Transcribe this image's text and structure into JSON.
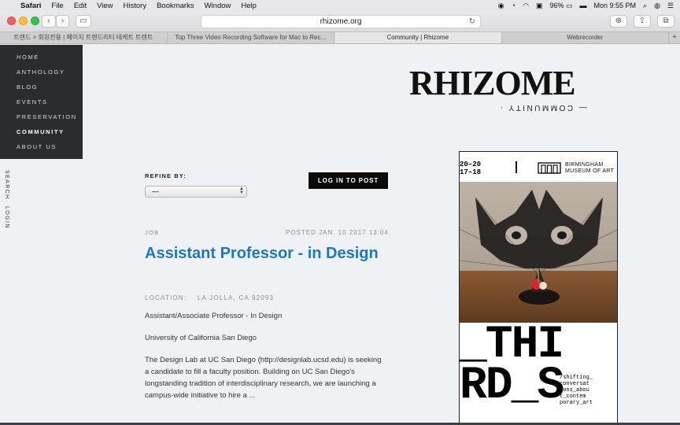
{
  "menubar": {
    "app_name": "Safari",
    "items": [
      "File",
      "Edit",
      "View",
      "History",
      "Bookmarks",
      "Window",
      "Help"
    ],
    "battery": "96%",
    "clock": "Mon 9:55 PM"
  },
  "toolbar": {
    "url": "rhizome.org"
  },
  "tabs": [
    "트렌드 > 회원전용 | 페이지 트렌드리티 테케트 트렌트",
    "Top Three Video Recording Software for Mac to Rec...",
    "Community | Rhizome",
    "Webrecorder"
  ],
  "nav": {
    "items": [
      "HOME",
      "ANTHOLOGY",
      "BLOG",
      "EVENTS",
      "PRESERVATION",
      "COMMUNITY",
      "ABOUT US"
    ],
    "search": "SEARCH",
    "login": "LOGIN"
  },
  "logo": {
    "title": "RHIZOME",
    "subtitle": "COMMUNITY"
  },
  "filters": {
    "refine_label": "REFINE BY:",
    "selected": "—"
  },
  "login_button": "LOG IN TO POST",
  "post": {
    "category": "JOB",
    "posted": "POSTED JAN. 10 2017 13:04",
    "title": "Assistant Professor - in Design",
    "location_label": "LOCATION:",
    "location_value": "LA JOLLA, CA 92093",
    "role": "Assistant/Associate Professor - In Design",
    "institution": "University of California San Diego",
    "description": "The Design Lab at UC San Diego (http://designlab.ucsd.edu) is seeking a candidate to fill a faculty position. Building on UC San Diego's longstanding tradition of interdisciplinary research, we are launching a campus-wide initiative to hire a ..."
  },
  "ad": {
    "year_top": "20–20",
    "year_bottom": "17–18",
    "museum_line1": "BIRMINGHAM",
    "museum_line2": "MUSEUM OF ART",
    "big_line1": "_THI",
    "big_line2": "RD_S",
    "small_text": "/shifting_ conversat ions_abou t_contem porary_art"
  }
}
